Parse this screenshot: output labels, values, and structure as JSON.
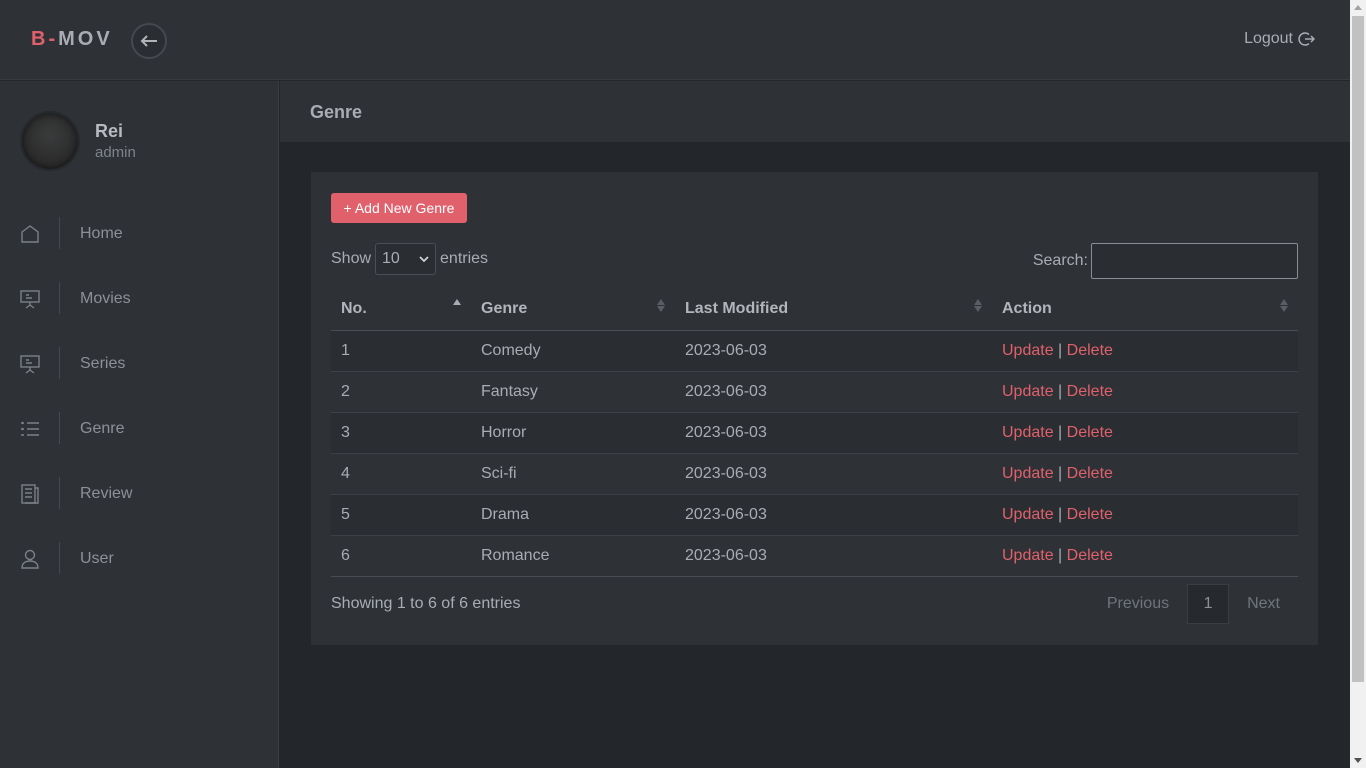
{
  "brand": {
    "prefix": "B-",
    "rest": "MOV"
  },
  "topbar": {
    "logout_label": "Logout"
  },
  "profile": {
    "name": "Rei",
    "role": "admin"
  },
  "sidebar": {
    "items": [
      {
        "label": "Home",
        "icon": "home-icon"
      },
      {
        "label": "Movies",
        "icon": "presentation-icon"
      },
      {
        "label": "Series",
        "icon": "presentation-icon"
      },
      {
        "label": "Genre",
        "icon": "list-icon"
      },
      {
        "label": "Review",
        "icon": "document-icon"
      },
      {
        "label": "User",
        "icon": "user-icon"
      }
    ]
  },
  "page": {
    "title": "Genre"
  },
  "toolbar": {
    "add_label": "+ Add New Genre"
  },
  "length": {
    "show": "Show",
    "value": "10",
    "entries": "entries"
  },
  "search": {
    "label": "Search:",
    "value": ""
  },
  "table": {
    "headers": [
      "No.",
      "Genre",
      "Last Modified",
      "Action"
    ],
    "rows": [
      {
        "no": "1",
        "genre": "Comedy",
        "modified": "2023-06-03"
      },
      {
        "no": "2",
        "genre": "Fantasy",
        "modified": "2023-06-03"
      },
      {
        "no": "3",
        "genre": "Horror",
        "modified": "2023-06-03"
      },
      {
        "no": "4",
        "genre": "Sci-fi",
        "modified": "2023-06-03"
      },
      {
        "no": "5",
        "genre": "Drama",
        "modified": "2023-06-03"
      },
      {
        "no": "6",
        "genre": "Romance",
        "modified": "2023-06-03"
      }
    ],
    "action_update": "Update",
    "action_sep": "|",
    "action_delete": "Delete"
  },
  "info": "Showing 1 to 6 of 6 entries",
  "pager": {
    "previous": "Previous",
    "current": "1",
    "next": "Next"
  },
  "colors": {
    "accent": "#e0616c",
    "bg": "#23262b",
    "panel": "#2e3136"
  }
}
